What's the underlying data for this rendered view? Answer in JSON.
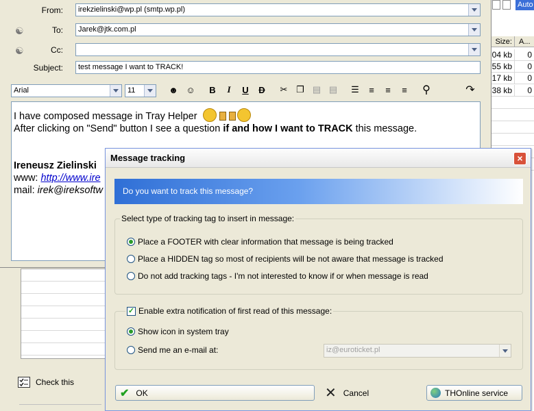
{
  "background": {
    "top_button": "Auto",
    "columns": [
      "Size:",
      "A..."
    ],
    "rows": [
      {
        "size": "04 kb",
        "a": "0"
      },
      {
        "size": "55 kb",
        "a": "0"
      },
      {
        "size": "17 kb",
        "a": "0"
      },
      {
        "size": "38 kb",
        "a": "0"
      }
    ],
    "check_this": "Check this"
  },
  "compose": {
    "from_label": "From:",
    "from_value": "irekzielinski@wp.pl  (smtp.wp.pl)",
    "to_label": "To:",
    "to_value": "Jarek@jtk.com.pl",
    "cc_label": "Cc:",
    "cc_value": "",
    "subject_label": "Subject:",
    "subject_value": "test message I want to TRACK!",
    "font_name": "Arial",
    "font_size": "11",
    "body": {
      "line1": "I have composed message in Tray Helper",
      "line2_a": "After clicking on \"Send\" button I see a question ",
      "line2_b": "if and how I want to TRACK",
      "line2_c": " this message.",
      "signature_name": "Ireneusz Zielinski",
      "www_label": "www: ",
      "www_link": "http://www.ire",
      "mail_label": "mail: ",
      "mail_value": "irek@ireksoftw"
    }
  },
  "dialog": {
    "title": "Message tracking",
    "banner": "Do you want to track this message?",
    "group1_legend": "Select type of tracking tag to insert in message:",
    "options": [
      {
        "label": "Place a FOOTER with clear information that message is being tracked",
        "selected": true
      },
      {
        "label": "Place a HIDDEN tag so most of recipients will be not aware that message is tracked",
        "selected": false
      },
      {
        "label": "Do not add tracking tags - I'm not interested to know if or when message is read",
        "selected": false
      }
    ],
    "extra_checkbox": "Enable extra notification of first read of this message:",
    "extra_checked": true,
    "notify_options": [
      {
        "label": "Show icon in system tray",
        "selected": true
      },
      {
        "label": "Send me an e-mail at:",
        "selected": false
      }
    ],
    "email_value": "iz@euroticket.pl",
    "ok_label": "OK",
    "cancel_label": "Cancel",
    "service_label": "THOnline service"
  },
  "colors": {
    "accent": "#2f6fd6",
    "ok_green": "#21a121",
    "close_red": "#d8523a"
  }
}
